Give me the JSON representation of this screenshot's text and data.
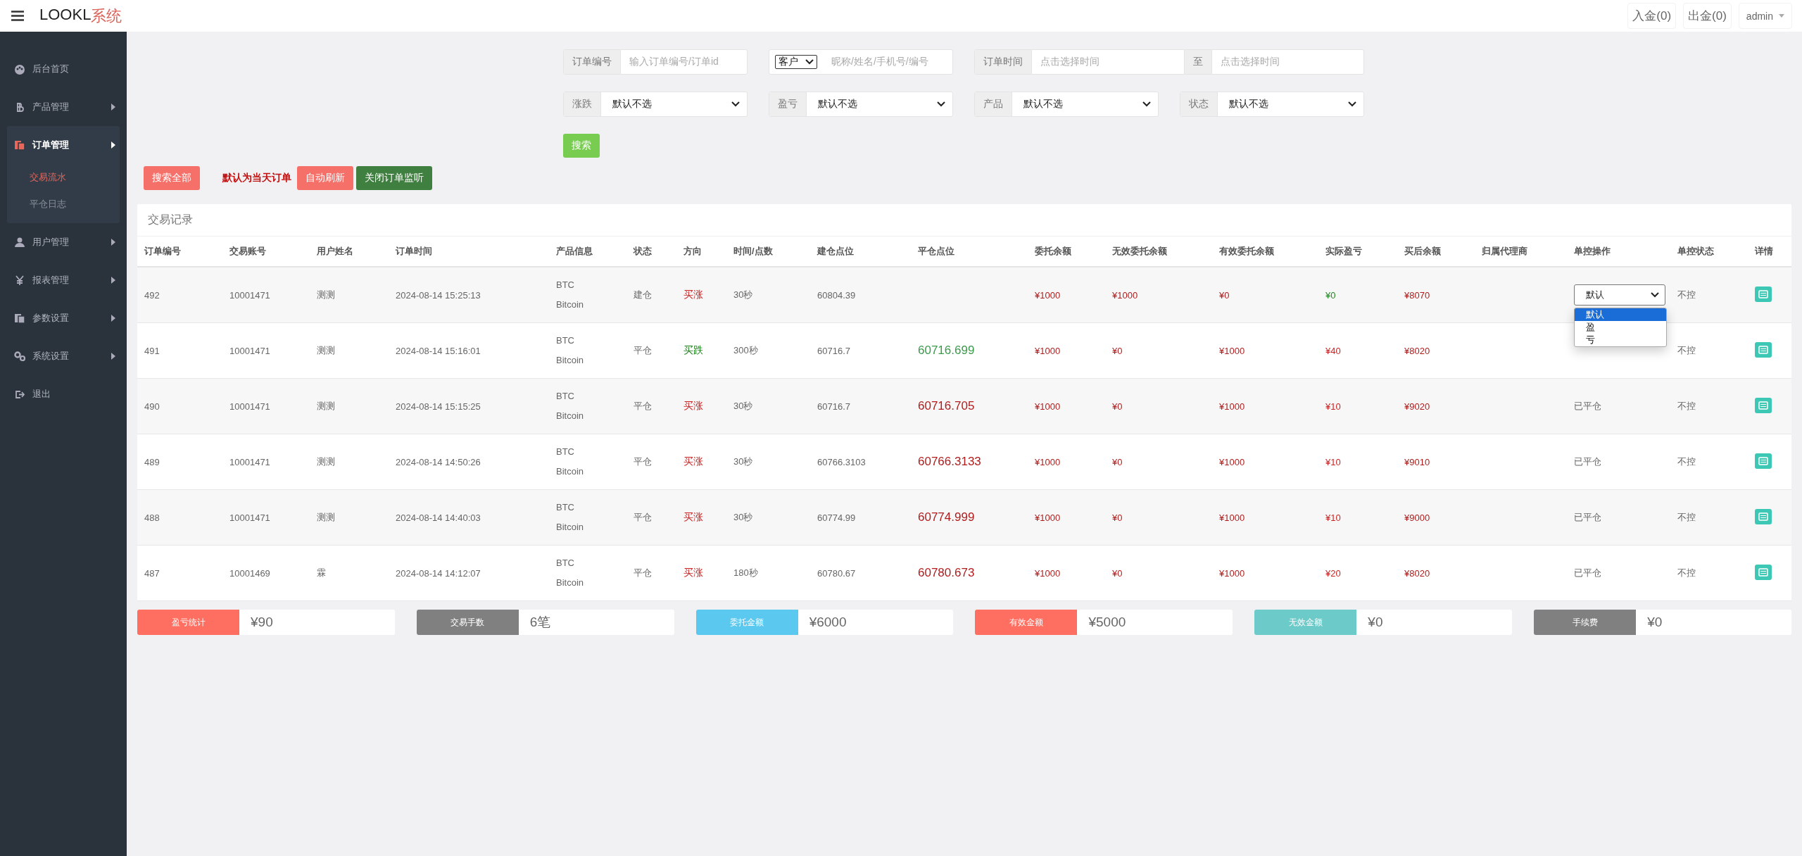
{
  "topbar": {
    "brand": {
      "name": "LOOKL",
      "suffix": "系统"
    },
    "actions": [
      {
        "label": "入金(0)",
        "kind": "button"
      },
      {
        "label": "出金(0)",
        "kind": "button"
      },
      {
        "label": "admin",
        "kind": "dropdown"
      }
    ]
  },
  "sidebar": {
    "items": [
      {
        "label": "后台首页",
        "kind": "link",
        "expanded": false
      },
      {
        "label": "产品管理",
        "kind": "menu",
        "expanded": false
      },
      {
        "label": "订单管理",
        "kind": "menu",
        "expanded": true,
        "children": [
          {
            "label": "交易流水",
            "selected": true
          },
          {
            "label": "平仓日志",
            "selected": false
          }
        ]
      },
      {
        "label": "用户管理",
        "kind": "menu",
        "expanded": false
      },
      {
        "label": "报表管理",
        "kind": "menu",
        "expanded": false
      },
      {
        "label": "参数设置",
        "kind": "menu",
        "expanded": false
      },
      {
        "label": "系统设置",
        "kind": "menu",
        "expanded": false
      },
      {
        "label": "退出",
        "kind": "link",
        "expanded": false
      }
    ]
  },
  "filters": {
    "row1": [
      {
        "kind": "input",
        "label": "订单编号",
        "placeholder": "输入订单编号/订单id"
      },
      {
        "kind": "select_input",
        "select": "客户",
        "placeholder": "昵称/姓名/手机号/编号"
      },
      {
        "kind": "range",
        "label": "订单时间",
        "placeholder": "点击选择时间",
        "separator": "至",
        "placeholder_end": "点击选择时间"
      }
    ],
    "row2": [
      {
        "label": "涨跌",
        "value": "默认不选"
      },
      {
        "label": "盈亏",
        "value": "默认不选"
      },
      {
        "label": "产品",
        "value": "默认不选"
      },
      {
        "label": "状态",
        "value": "默认不选"
      }
    ],
    "search_button": "搜索"
  },
  "toolbar": {
    "search_all": "搜索全部",
    "note": "默认为当天订单",
    "auto_refresh": "自动刷新",
    "close_monitor": "关闭订单监听"
  },
  "table": {
    "title": "交易记录",
    "columns": [
      "订单编号",
      "交易账号",
      "用户姓名",
      "订单时间",
      "产品信息",
      "状态",
      "方向",
      "时间/点数",
      "建仓点位",
      "平仓点位",
      "委托余额",
      "无效委托余额",
      "有效委托余额",
      "实际盈亏",
      "买后余额",
      "归属代理商",
      "单控操作",
      "单控状态",
      "详情"
    ],
    "rows": [
      {
        "id": "492",
        "account": "10001471",
        "name": "测测",
        "time": "2024-08-14 15:25:13",
        "product": "BTC",
        "product_name": "Bitcoin",
        "status": "建仓",
        "direction": {
          "text": "买涨",
          "color": "#cc2222"
        },
        "duration": "30秒",
        "open_price": "60804.39",
        "entrust": "¥1000",
        "invalid": "¥1000",
        "valid": "¥0",
        "profit": {
          "text": "¥0",
          "color": "#228822"
        },
        "balance": "¥8070",
        "control": {
          "kind": "select",
          "value": "默认",
          "open": true,
          "options": [
            {
              "label": "默认",
              "selected": true
            },
            {
              "label": "盈",
              "selected": false
            },
            {
              "label": "亏",
              "selected": false
            }
          ]
        },
        "control_status": "不控"
      },
      {
        "id": "491",
        "account": "10001471",
        "name": "测测",
        "time": "2024-08-14 15:16:01",
        "product": "BTC",
        "product_name": "Bitcoin",
        "status": "平仓",
        "direction": {
          "text": "买跌",
          "color": "#1a801a"
        },
        "duration": "300秒",
        "open_price": "60716.7",
        "close_price": {
          "text": "60716.699",
          "color": "#3a9a4a"
        },
        "entrust": "¥1000",
        "invalid": "¥0",
        "valid": "¥1000",
        "profit": {
          "text": "¥40",
          "color": "#cc2222"
        },
        "balance": "¥8020",
        "control_status": "不控"
      },
      {
        "id": "490",
        "account": "10001471",
        "name": "测测",
        "time": "2024-08-14 15:15:25",
        "product": "BTC",
        "product_name": "Bitcoin",
        "status": "平仓",
        "direction": {
          "text": "买涨",
          "color": "#cc2222"
        },
        "duration": "30秒",
        "open_price": "60716.7",
        "close_price": {
          "text": "60716.705",
          "color": "#b01c1c"
        },
        "entrust": "¥1000",
        "invalid": "¥0",
        "valid": "¥1000",
        "profit": {
          "text": "¥10",
          "color": "#cc2222"
        },
        "balance": "¥9020",
        "control": {
          "kind": "text",
          "value": "已平仓"
        },
        "control_status": "不控"
      },
      {
        "id": "489",
        "account": "10001471",
        "name": "测测",
        "time": "2024-08-14 14:50:26",
        "product": "BTC",
        "product_name": "Bitcoin",
        "status": "平仓",
        "direction": {
          "text": "买涨",
          "color": "#cc2222"
        },
        "duration": "30秒",
        "open_price": "60766.3103",
        "close_price": {
          "text": "60766.3133",
          "color": "#b01c1c"
        },
        "entrust": "¥1000",
        "invalid": "¥0",
        "valid": "¥1000",
        "profit": {
          "text": "¥10",
          "color": "#cc2222"
        },
        "balance": "¥9010",
        "control": {
          "kind": "text",
          "value": "已平仓"
        },
        "control_status": "不控"
      },
      {
        "id": "488",
        "account": "10001471",
        "name": "测测",
        "time": "2024-08-14 14:40:03",
        "product": "BTC",
        "product_name": "Bitcoin",
        "status": "平仓",
        "direction": {
          "text": "买涨",
          "color": "#cc2222"
        },
        "duration": "30秒",
        "open_price": "60774.99",
        "close_price": {
          "text": "60774.999",
          "color": "#b01c1c"
        },
        "entrust": "¥1000",
        "invalid": "¥0",
        "valid": "¥1000",
        "profit": {
          "text": "¥10",
          "color": "#cc2222"
        },
        "balance": "¥9000",
        "control": {
          "kind": "text",
          "value": "已平仓"
        },
        "control_status": "不控"
      },
      {
        "id": "487",
        "account": "10001469",
        "name": "霖",
        "time": "2024-08-14 14:12:07",
        "product": "BTC",
        "product_name": "Bitcoin",
        "status": "平仓",
        "direction": {
          "text": "买涨",
          "color": "#cc2222"
        },
        "duration": "180秒",
        "open_price": "60780.67",
        "close_price": {
          "text": "60780.673",
          "color": "#b01c1c"
        },
        "entrust": "¥1000",
        "invalid": "¥0",
        "valid": "¥1000",
        "profit": {
          "text": "¥20",
          "color": "#cc2222"
        },
        "balance": "¥8020",
        "control": {
          "kind": "text",
          "value": "已平仓"
        },
        "control_status": "不控"
      }
    ]
  },
  "stats": [
    {
      "label": "盈亏统计",
      "value": "¥90",
      "color": "#ff6f61"
    },
    {
      "label": "交易手数",
      "value": "6笔",
      "color": "#808080"
    },
    {
      "label": "委托金额",
      "value": "¥6000",
      "color": "#5bc8ef"
    },
    {
      "label": "有效金额",
      "value": "¥5000",
      "color": "#ff6f61"
    },
    {
      "label": "无效金额",
      "value": "¥0",
      "color": "#6ccac9"
    },
    {
      "label": "手续费",
      "value": "¥0",
      "color": "#808080"
    }
  ]
}
